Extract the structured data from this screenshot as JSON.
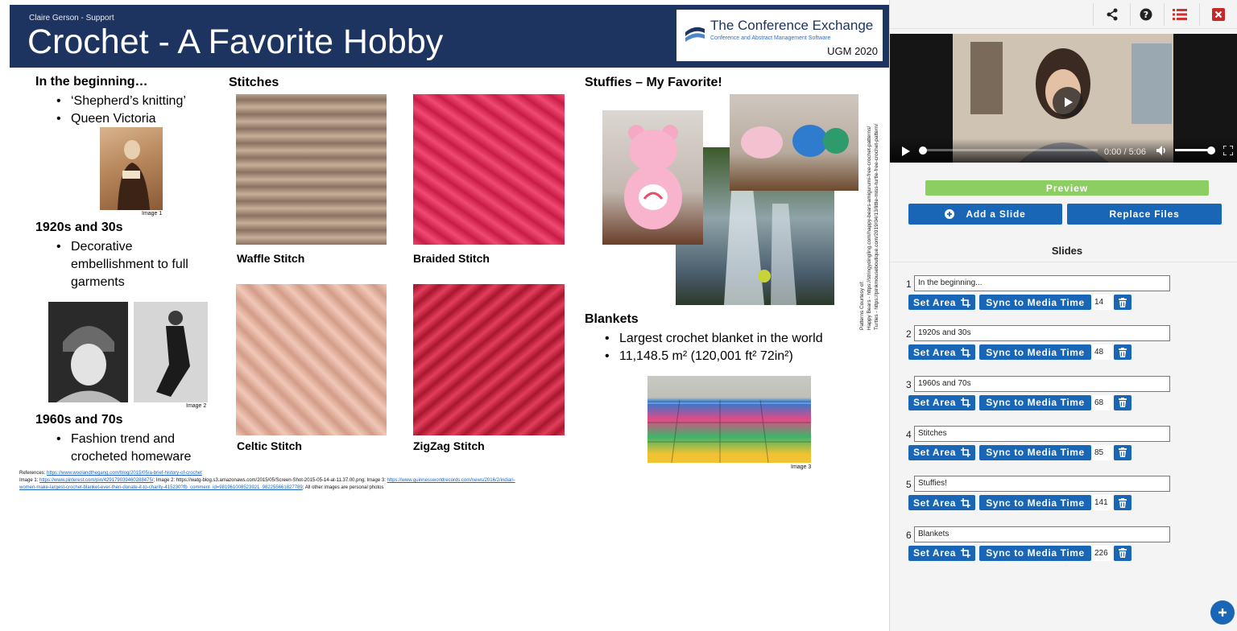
{
  "slide": {
    "presenter": "Claire Gerson - Support",
    "title": "Crochet - A Favorite Hobby",
    "logo": {
      "name": "The Conference Exchange",
      "tagline": "Conference and Abstract Management Software",
      "event": "UGM 2020"
    },
    "beginning": {
      "heading": "In the beginning…",
      "bullets": [
        "‘Shepherd’s knitting’",
        "Queen Victoria"
      ],
      "image_caption": "Image 1"
    },
    "twenties": {
      "heading": "1920s and 30s",
      "bullets": [
        "Decorative embellishment to full garments"
      ],
      "image_caption": "Image 2"
    },
    "sixties": {
      "heading": "1960s and 70s",
      "bullets": [
        "Fashion trend and crocheted homeware"
      ]
    },
    "stitches": {
      "heading": "Stitches",
      "items": [
        {
          "label": "Waffle Stitch",
          "color": "#b39a86"
        },
        {
          "label": "Braided Stitch",
          "color": "#e8305c"
        },
        {
          "label": "Celtic Stitch",
          "color": "#e7b6a6"
        },
        {
          "label": "ZigZag Stitch",
          "color": "#cf2b47"
        }
      ]
    },
    "stuffies": {
      "heading": "Stuffies – My Favorite!"
    },
    "blankets": {
      "heading": "Blankets",
      "bullets": [
        "Largest crochet blanket in the world",
        "11,148.5 m² (120,001 ft² 72in²)"
      ],
      "image_caption": "Image 3"
    },
    "credits": {
      "lines": [
        "Patterns Courtesy of:",
        "Happy Bears - https://stringydingling.com/happy-bears-amigurumi-free-crochet-patterns/",
        "Turtles - https://pinkmouseboutique.com/2019/04/13/little-miss-turtle-free-crochet-pattern/"
      ]
    },
    "references": {
      "label": "References:",
      "ref_link": "https://www.woolandthegang.com/blog/2015/05/a-brief-history-of-crochet",
      "image1_label": "Image 1:",
      "image1_link": "https://www.pinterest.com/pin/429179039460288475/",
      "image2_text": "; Image 2: https://watg-blog.s3.amazonaws.com/2015/05/Screen-Shot-2015-05-14-at-11.37.00.png; Image 3:",
      "image3_link": "https://www.guinnessworldrecords.com/news/2016/2/indian-",
      "image3_link_cont": "women-make-largest-crochet-blanket-ever-then-donate-it-to-charity-415230?fb_comment_id=981961008523921_982255661827789",
      "tail": "; All other images are personal photos"
    }
  },
  "panel": {
    "video": {
      "time": "0:00 / 5:06",
      "progress": 0.0,
      "volume": 0.95
    },
    "preview_label": "Preview",
    "add_slide_label": "Add a Slide",
    "replace_files_label": "Replace Files",
    "slides_title": "Slides",
    "set_area_label": "Set Area",
    "sync_label": "Sync to Media Time",
    "rows": [
      {
        "num": "1",
        "title": "In the beginning...",
        "time": "14"
      },
      {
        "num": "2",
        "title": "1920s and 30s",
        "time": "48"
      },
      {
        "num": "3",
        "title": "1960s and 70s",
        "time": "68"
      },
      {
        "num": "4",
        "title": "Stitches",
        "time": "85"
      },
      {
        "num": "5",
        "title": "Stuffies!",
        "time": "141"
      },
      {
        "num": "6",
        "title": "Blankets",
        "time": "226"
      }
    ],
    "colors": {
      "accent": "#1a66b6",
      "preview": "#8dce62",
      "header": "#1d3461",
      "close": "#c62828"
    }
  }
}
